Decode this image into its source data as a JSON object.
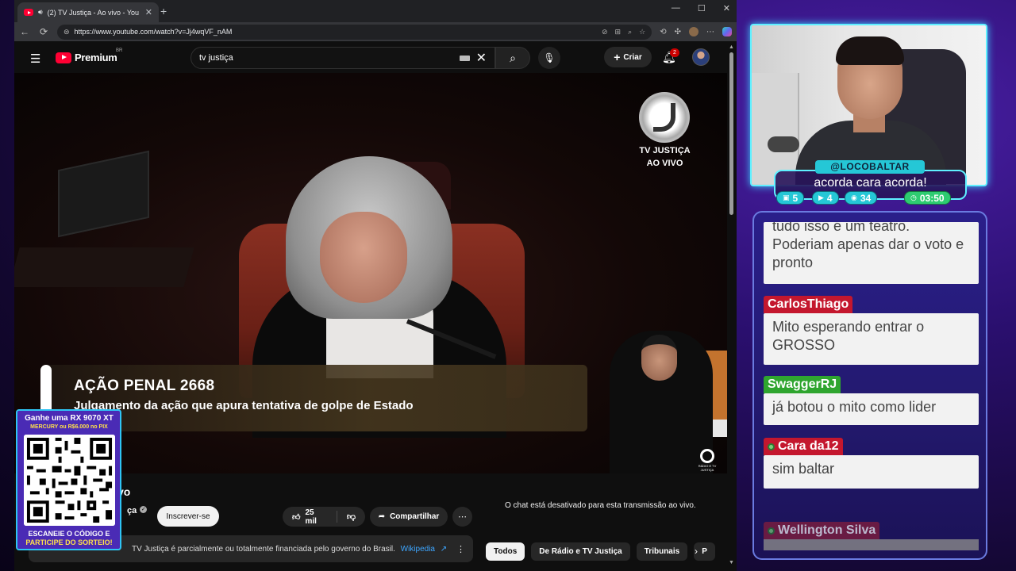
{
  "browser": {
    "tab_title": "(2) TV Justiça - Ao vivo - You",
    "url": "https://www.youtube.com/watch?v=Jj4wqVF_nAM"
  },
  "youtube": {
    "logo_text": "Premium",
    "region": "BR",
    "search_value": "tv justiça",
    "create_label": "Criar",
    "notification_count": "2"
  },
  "video": {
    "channel_watermark": "TV JUSTIÇA",
    "live_watermark": "AO VIVO",
    "lower_third_title": "AÇÃO PENAL 2668",
    "lower_third_subtitle": "Julgamento da ação que apura tentativa de golpe de Estado",
    "small_logo_text": "RÁDIO E TV JUSTIÇA"
  },
  "below_video": {
    "title_fragment": "vo",
    "channel_fragment": "ça",
    "subscribe_label": "Inscrever-se",
    "likes": "25 mil",
    "share_label": "Compartilhar",
    "chat_disabled": "O chat está desativado para esta transmissão ao vivo.",
    "info_text": "TV Justiça é parcialmente ou totalmente financiada pelo governo do Brasil.",
    "info_link": "Wikipedia",
    "chips": [
      "Todos",
      "De Rádio e TV Justiça",
      "Tribunais",
      "P"
    ]
  },
  "promo": {
    "headline": "Ganhe uma RX 9070 XT",
    "subline": "MERCURY ou R$6.000 no PIX",
    "bottom1": "ESCANEIE O CÓDIGO E",
    "bottom2": "PARTICIPE DO SORTEIO!"
  },
  "overlay": {
    "alert_name": "@LOCOBALTAR",
    "alert_message": "acorda cara acorda!",
    "stats": [
      {
        "icon": "twitch-icon",
        "value": "5"
      },
      {
        "icon": "youtube-icon",
        "value": "4"
      },
      {
        "icon": "kick-icon",
        "value": "34"
      },
      {
        "icon": "clock-icon",
        "value": "03:50"
      }
    ]
  },
  "chat": {
    "messages": [
      {
        "user": "",
        "text": "tudo isso é um teatro. Poderiam apenas dar o voto e pronto"
      },
      {
        "user": "CarlosThiago",
        "text": "Mito esperando entrar o GROSSO"
      },
      {
        "user": "SwaggerRJ",
        "text": "já botou o mito como lider"
      },
      {
        "user": "Cara da12",
        "text": "sim baltar"
      },
      {
        "user": "Wellington Silva",
        "text": ""
      }
    ]
  },
  "colors": {
    "youtube_red": "#ff0033",
    "overlay_cyan": "#5ff0ff",
    "chat_name_red": "#c4172e",
    "chat_name_green": "#2fa52f"
  }
}
